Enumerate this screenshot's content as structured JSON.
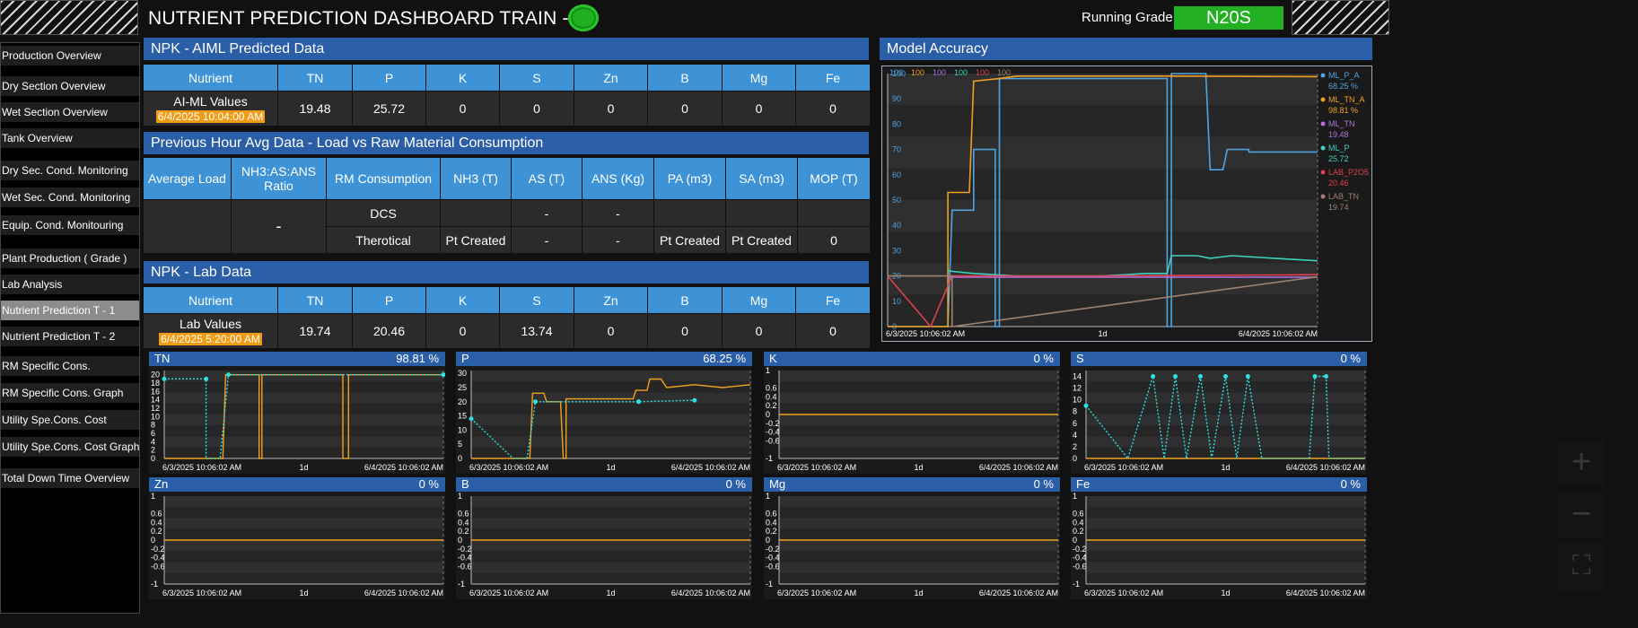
{
  "header": {
    "title": "NUTRIENT PREDICTION DASHBOARD TRAIN - 1",
    "running_grade_label": "Running Grade",
    "running_grade_value": "N20S",
    "status_color": "#1fb021"
  },
  "sidebar": {
    "active": "Nutrient Prediction T - 1",
    "items": [
      {
        "label": "Production Overview"
      },
      {
        "label": "Dry Section Overview"
      },
      {
        "label": "Wet Section Overview"
      },
      {
        "label": "Tank Overview"
      },
      {
        "label": "Dry Sec. Cond. Monitoring"
      },
      {
        "label": "Wet Sec. Cond. Monitoring"
      },
      {
        "label": "Equip. Cond. Monitouring"
      },
      {
        "label": "Plant Production ( Grade )"
      },
      {
        "label": "Lab Analysis"
      },
      {
        "label": "Nutrient Prediction T - 1"
      },
      {
        "label": "Nutrient Prediction T - 2"
      },
      {
        "label": "RM Specific Cons."
      },
      {
        "label": "RM Specific Cons. Graph"
      },
      {
        "label": "Utility Spe.Cons. Cost"
      },
      {
        "label": "Utility Spe.Cons. Cost Graph"
      },
      {
        "label": "Total Down Time Overview"
      }
    ]
  },
  "aiml": {
    "title": "NPK - AIML Predicted Data",
    "headers": [
      "Nutrient",
      "TN",
      "P",
      "K",
      "S",
      "Zn",
      "B",
      "Mg",
      "Fe"
    ],
    "row_label": "AI-ML Values",
    "timestamp": "6/4/2025 10:04:00 AM",
    "values": [
      "19.48",
      "25.72",
      "0",
      "0",
      "0",
      "0",
      "0",
      "0"
    ]
  },
  "prev_hour": {
    "title": "Previous Hour Avg Data - Load vs Raw Material Consumption",
    "headers": [
      "Average Load",
      "NH3:AS:ANS Ratio",
      "RM Consumption",
      "NH3 (T)",
      "AS (T)",
      "ANS (Kg)",
      "PA (m3)",
      "SA (m3)",
      "MOP (T)"
    ],
    "ratio_value": "-",
    "rows": [
      {
        "label": "DCS",
        "nh3": "",
        "as": "-",
        "ans": "-",
        "pa": "",
        "sa": "",
        "mop": ""
      },
      {
        "label": "Therotical",
        "nh3": "Pt Created",
        "as": "-",
        "ans": "-",
        "pa": "Pt Created",
        "sa": "Pt Created",
        "mop": "0"
      }
    ]
  },
  "lab": {
    "title": "NPK - Lab Data",
    "headers": [
      "Nutrient",
      "TN",
      "P",
      "K",
      "S",
      "Zn",
      "B",
      "Mg",
      "Fe"
    ],
    "row_label": "Lab Values",
    "timestamp": "6/4/2025 5:20:00 AM",
    "values": [
      "19.74",
      "20.46",
      "0",
      "13.74",
      "0",
      "0",
      "0",
      "0"
    ]
  },
  "accuracy": {
    "title": "Model Accuracy",
    "top_labels": [
      {
        "text": "100",
        "color": "#4fa3e0"
      },
      {
        "text": "100",
        "color": "#f0a020"
      },
      {
        "text": "100",
        "color": "#b070e0"
      },
      {
        "text": "100",
        "color": "#3ed0c0"
      },
      {
        "text": "100",
        "color": "#e04050"
      },
      {
        "text": "100",
        "color": "#a08070"
      }
    ],
    "legend": [
      {
        "name": "ML_P_A",
        "value": "68.25 %",
        "color": "#4fa3e0"
      },
      {
        "name": "ML_TN_A",
        "value": "98.81 %",
        "color": "#f0a020"
      },
      {
        "name": "ML_TN",
        "value": "19.48",
        "color": "#b070e0"
      },
      {
        "name": "ML_P",
        "value": "25.72",
        "color": "#3ed0c0"
      },
      {
        "name": "LAB_P2O5",
        "value": "20.46",
        "color": "#e04050"
      },
      {
        "name": "LAB_TN",
        "value": "19.74",
        "color": "#a08070"
      }
    ],
    "x_start": "6/3/2025 10:06:02 AM",
    "x_mid": "1d",
    "x_end": "6/4/2025 10:06:02 AM"
  },
  "chart_data": [
    {
      "type": "line",
      "title": "Model Accuracy",
      "yticks": [
        0,
        10,
        20,
        30,
        40,
        50,
        60,
        70,
        80,
        90,
        100
      ],
      "ylim": [
        0,
        100
      ],
      "x_labels": [
        "6/3/2025 10:06:02 AM",
        "1d",
        "6/4/2025 10:06:02 AM"
      ],
      "legend_position": "right",
      "series": [
        {
          "name": "ML_P_A",
          "color": "#4fa3e0",
          "points": [
            [
              0,
              0
            ],
            [
              0.05,
              0
            ],
            [
              0.1,
              0
            ],
            [
              0.14,
              0
            ],
            [
              0.15,
              46
            ],
            [
              0.2,
              46
            ],
            [
              0.2,
              70
            ],
            [
              0.25,
              70
            ],
            [
              0.25,
              0
            ],
            [
              0.26,
              0
            ],
            [
              0.26,
              98
            ],
            [
              0.65,
              98
            ],
            [
              0.65,
              0
            ],
            [
              0.66,
              0
            ],
            [
              0.66,
              100
            ],
            [
              0.74,
              100
            ],
            [
              0.75,
              62
            ],
            [
              0.78,
              62
            ],
            [
              0.79,
              70
            ],
            [
              0.84,
              70
            ],
            [
              0.84,
              69
            ],
            [
              1,
              69
            ]
          ]
        },
        {
          "name": "ML_TN_A",
          "color": "#f0a020",
          "points": [
            [
              0,
              0
            ],
            [
              0.14,
              0
            ],
            [
              0.14,
              53
            ],
            [
              0.19,
              53
            ],
            [
              0.2,
              97
            ],
            [
              0.26,
              98
            ],
            [
              0.3,
              99
            ],
            [
              0.5,
              99
            ],
            [
              0.66,
              99
            ],
            [
              1,
              98.8
            ]
          ]
        },
        {
          "name": "ML_TN",
          "color": "#b070e0",
          "points": [
            [
              0.14,
              19.5
            ],
            [
              1,
              19.5
            ]
          ]
        },
        {
          "name": "ML_P",
          "color": "#3ed0c0",
          "points": [
            [
              0.14,
              22
            ],
            [
              0.2,
              21
            ],
            [
              0.3,
              20
            ],
            [
              0.5,
              20
            ],
            [
              0.6,
              21
            ],
            [
              0.65,
              21
            ],
            [
              0.66,
              28
            ],
            [
              0.72,
              28
            ],
            [
              0.75,
              27
            ],
            [
              0.8,
              28
            ],
            [
              0.9,
              27
            ],
            [
              1,
              26
            ]
          ]
        },
        {
          "name": "LAB_P2O5",
          "color": "#e04050",
          "points": [
            [
              0,
              20
            ],
            [
              0.1,
              0
            ],
            [
              0.15,
              20
            ],
            [
              0.25,
              20
            ],
            [
              0.5,
              20
            ],
            [
              1,
              20.5
            ]
          ]
        },
        {
          "name": "LAB_TN",
          "color": "#a08070",
          "points": [
            [
              0,
              20
            ],
            [
              0.15,
              20
            ],
            [
              0.15,
              0
            ],
            [
              1,
              19.7
            ]
          ]
        }
      ]
    },
    {
      "type": "line",
      "title": "TN",
      "accuracy": "98.81 %",
      "yticks": [
        0,
        2,
        4,
        6,
        8,
        10,
        12,
        14,
        16,
        18,
        20
      ],
      "ylim": [
        0,
        21
      ],
      "x_labels": [
        "6/3/2025 10:06:02 AM",
        "1d",
        "6/4/2025 10:06:02 AM"
      ],
      "series": [
        {
          "name": "Predicted",
          "color": "#f0a020",
          "points": [
            [
              0,
              0
            ],
            [
              0.21,
              0
            ],
            [
              0.22,
              20
            ],
            [
              0.34,
              20
            ],
            [
              0.34,
              0
            ],
            [
              0.35,
              0
            ],
            [
              0.35,
              20
            ],
            [
              0.64,
              20
            ],
            [
              0.64,
              0
            ],
            [
              0.66,
              0
            ],
            [
              0.66,
              20
            ],
            [
              1,
              20
            ]
          ]
        },
        {
          "name": "Lab",
          "color": "#2ee0e0",
          "dashed": true,
          "points": [
            [
              0,
              19
            ],
            [
              0.15,
              19
            ],
            [
              0.15,
              0
            ],
            [
              0.2,
              0
            ],
            [
              0.23,
              20
            ],
            [
              1,
              20
            ]
          ]
        }
      ]
    },
    {
      "type": "line",
      "title": "P",
      "accuracy": "68.25 %",
      "yticks": [
        0,
        5,
        10,
        15,
        20,
        25,
        30
      ],
      "ylim": [
        0,
        31
      ],
      "x_labels": [
        "6/3/2025 10:06:02 AM",
        "1d",
        "6/4/2025 10:06:02 AM"
      ],
      "series": [
        {
          "name": "Predicted",
          "color": "#f0a020",
          "points": [
            [
              0,
              0
            ],
            [
              0.21,
              0
            ],
            [
              0.22,
              23
            ],
            [
              0.26,
              23
            ],
            [
              0.27,
              20
            ],
            [
              0.32,
              20
            ],
            [
              0.33,
              0
            ],
            [
              0.34,
              0
            ],
            [
              0.34,
              21
            ],
            [
              0.58,
              21
            ],
            [
              0.59,
              24
            ],
            [
              0.63,
              24
            ],
            [
              0.64,
              28
            ],
            [
              0.68,
              28
            ],
            [
              0.7,
              25
            ],
            [
              0.8,
              26
            ],
            [
              0.9,
              25
            ],
            [
              1,
              26
            ]
          ]
        },
        {
          "name": "Lab",
          "color": "#2ee0e0",
          "dashed": true,
          "points": [
            [
              0,
              14
            ],
            [
              0.15,
              0
            ],
            [
              0.2,
              0
            ],
            [
              0.23,
              20
            ],
            [
              0.6,
              20
            ],
            [
              0.6,
              20
            ],
            [
              0.8,
              20.5
            ]
          ]
        }
      ]
    },
    {
      "type": "line",
      "title": "K",
      "accuracy": "0 %",
      "yticks": [
        -1,
        -0.6,
        -0.4,
        -0.2,
        0,
        0.2,
        0.4,
        0.6,
        1
      ],
      "ylim": [
        -1,
        1
      ],
      "x_labels": [
        "6/3/2025 10:06:02 AM",
        "1d",
        "6/4/2025 10:06:02 AM"
      ],
      "series": [
        {
          "name": "Predicted",
          "color": "#f0a020",
          "points": [
            [
              0,
              0
            ],
            [
              1,
              0
            ]
          ]
        }
      ]
    },
    {
      "type": "line",
      "title": "S",
      "accuracy": "0 %",
      "yticks": [
        0,
        2,
        4,
        6,
        8,
        10,
        12,
        14
      ],
      "ylim": [
        0,
        15
      ],
      "x_labels": [
        "6/3/2025 10:06:02 AM",
        "1d",
        "6/4/2025 10:06:02 AM"
      ],
      "series": [
        {
          "name": "Predicted",
          "color": "#f0a020",
          "points": [
            [
              0,
              0
            ],
            [
              1,
              0
            ]
          ]
        },
        {
          "name": "Lab",
          "color": "#2ee0e0",
          "dashed": true,
          "points": [
            [
              0,
              9
            ],
            [
              0.15,
              0
            ],
            [
              0.24,
              14
            ],
            [
              0.28,
              0
            ],
            [
              0.32,
              14
            ],
            [
              0.36,
              0
            ],
            [
              0.41,
              14
            ],
            [
              0.45,
              0
            ],
            [
              0.5,
              14
            ],
            [
              0.54,
              0
            ],
            [
              0.58,
              14
            ],
            [
              0.63,
              0
            ],
            [
              0.72,
              0
            ],
            [
              0.76,
              0
            ],
            [
              0.8,
              0
            ],
            [
              0.82,
              14
            ],
            [
              0.86,
              14
            ],
            [
              0.87,
              0
            ],
            [
              1,
              0
            ]
          ]
        }
      ]
    },
    {
      "type": "line",
      "title": "Zn",
      "accuracy": "0 %",
      "yticks": [
        -1,
        -0.6,
        -0.4,
        -0.2,
        0,
        0.2,
        0.4,
        0.6,
        1
      ],
      "ylim": [
        -1,
        1
      ],
      "x_labels": [
        "6/3/2025 10:06:02 AM",
        "1d",
        "6/4/2025 10:06:02 AM"
      ],
      "series": [
        {
          "name": "Predicted",
          "color": "#f0a020",
          "points": [
            [
              0,
              0
            ],
            [
              1,
              0
            ]
          ]
        }
      ]
    },
    {
      "type": "line",
      "title": "B",
      "accuracy": "0 %",
      "yticks": [
        -1,
        -0.6,
        -0.4,
        -0.2,
        0,
        0.2,
        0.4,
        0.6,
        1
      ],
      "ylim": [
        -1,
        1
      ],
      "x_labels": [
        "6/3/2025 10:06:02 AM",
        "1d",
        "6/4/2025 10:06:02 AM"
      ],
      "series": [
        {
          "name": "Predicted",
          "color": "#f0a020",
          "points": [
            [
              0,
              0
            ],
            [
              1,
              0
            ]
          ]
        }
      ]
    },
    {
      "type": "line",
      "title": "Mg",
      "accuracy": "0 %",
      "yticks": [
        -1,
        -0.6,
        -0.4,
        -0.2,
        0,
        0.2,
        0.4,
        0.6,
        1
      ],
      "ylim": [
        -1,
        1
      ],
      "x_labels": [
        "6/3/2025 10:06:02 AM",
        "1d",
        "6/4/2025 10:06:02 AM"
      ],
      "series": [
        {
          "name": "Predicted",
          "color": "#f0a020",
          "points": [
            [
              0,
              0
            ],
            [
              1,
              0
            ]
          ]
        }
      ]
    },
    {
      "type": "line",
      "title": "Fe",
      "accuracy": "0 %",
      "yticks": [
        -1,
        -0.6,
        -0.4,
        -0.2,
        0,
        0.2,
        0.4,
        0.6,
        1
      ],
      "ylim": [
        -1,
        1
      ],
      "x_labels": [
        "6/3/2025 10:06:02 AM",
        "1d",
        "6/4/2025 10:06:02 AM"
      ],
      "series": [
        {
          "name": "Predicted",
          "color": "#f0a020",
          "points": [
            [
              0,
              0
            ],
            [
              1,
              0
            ]
          ]
        }
      ]
    }
  ],
  "zoom_controls": [
    {
      "icon": "zoom-in-icon",
      "glyph": "+"
    },
    {
      "icon": "zoom-out-icon",
      "glyph": "−"
    },
    {
      "icon": "fit-screen-icon",
      "glyph": "⛶"
    }
  ]
}
